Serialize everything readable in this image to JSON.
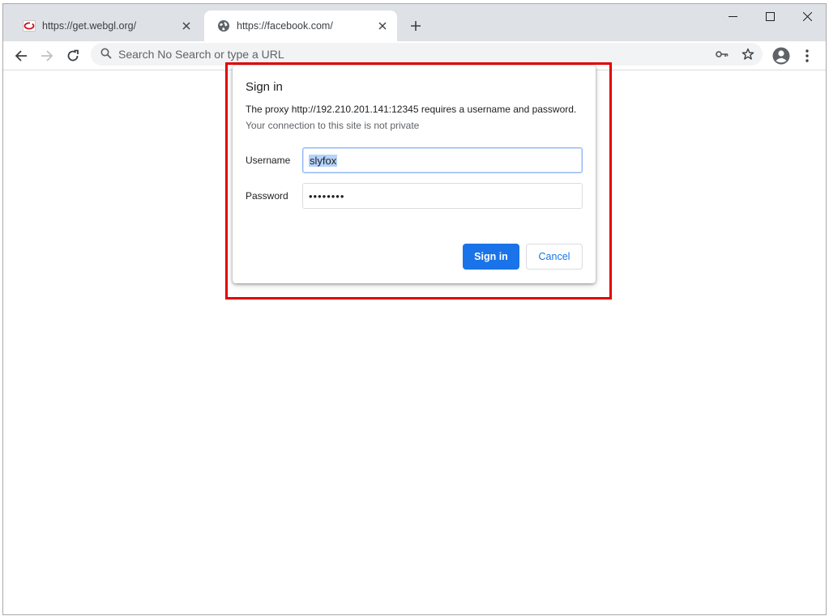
{
  "tabs": [
    {
      "title": "https://get.webgl.org/",
      "favicon": "webgl-logo-icon",
      "active": false
    },
    {
      "title": "https://facebook.com/",
      "favicon": "globe-icon",
      "active": true
    }
  ],
  "toolbar": {
    "omnibox_placeholder": "Search No Search or type a URL"
  },
  "dialog": {
    "title": "Sign in",
    "message": "The proxy http://192.210.201.141:12345 requires a username and password.",
    "submessage": "Your connection to this site is not private",
    "username_label": "Username",
    "username_value": "slyfox",
    "password_label": "Password",
    "password_value": "••••••••",
    "signin_button": "Sign in",
    "cancel_button": "Cancel"
  },
  "colors": {
    "accent": "#1a73e8",
    "highlight_border": "#e30000",
    "tabstrip_bg": "#dee1e6"
  }
}
